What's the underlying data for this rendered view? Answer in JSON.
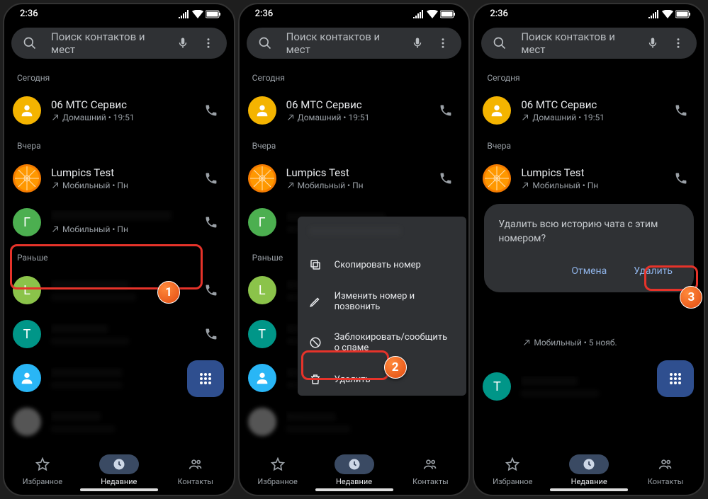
{
  "status": {
    "time": "2:36"
  },
  "search": {
    "placeholder": "Поиск контактов и мест"
  },
  "sections": {
    "today": "Сегодня",
    "yesterday": "Вчера",
    "earlier": "Раньше"
  },
  "calls": {
    "mts": {
      "name": "06 МТС Сервис",
      "sub": "Домашний • 19:51",
      "avatar_bg": "#f4b400",
      "avatar_letter": ""
    },
    "lumpics": {
      "name": "Lumpics Test",
      "sub": "Мобильный • Пн",
      "avatar_bg": "#f57c00",
      "avatar_letter": ""
    },
    "g1": {
      "name": "████████ ██████",
      "sub": "Мобильный • Пн",
      "avatar_bg": "#4caf50",
      "avatar_letter": "Г"
    },
    "g2": {
      "name": "████████ ██████",
      "sub": "Мобильный • Пн",
      "avatar_bg": "#4caf50",
      "avatar_letter": "Г"
    },
    "l": {
      "name": "████████",
      "sub": "█ ████████ █████",
      "avatar_bg": "#8bc34a",
      "avatar_letter": "L"
    },
    "t": {
      "name": "██████",
      "sub": "█ ███████ █████",
      "avatar_bg": "#009688",
      "avatar_letter": "T"
    },
    "blue": {
      "name": "████████",
      "sub": "█ ████████",
      "avatar_bg": "#29b6f6",
      "avatar_letter": ""
    },
    "last": {
      "name": "████████",
      "sub": "███████",
      "avatar_bg": "#555",
      "avatar_letter": ""
    },
    "g3_sub_panel3": "Мобильный • 5 нояб."
  },
  "context_menu": {
    "header": "+█ ███ ██ ██ ███",
    "copy": "Скопировать номер",
    "edit": "Изменить номер и позвонить",
    "block": "Заблокировать/сообщить о спаме",
    "delete": "Удалить"
  },
  "dialog": {
    "text": "Удалить всю историю чата с этим номером?",
    "cancel": "Отмена",
    "confirm": "Удалить"
  },
  "nav": {
    "fav": "Избранное",
    "recent": "Недавние",
    "contacts": "Контакты"
  }
}
